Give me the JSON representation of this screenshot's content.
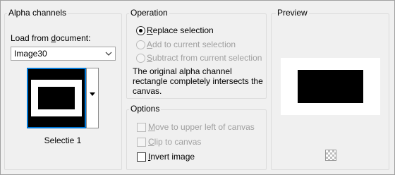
{
  "alpha_channels": {
    "title": "Alpha channels",
    "load_label_pre": "Load from ",
    "load_label_u": "d",
    "load_label_post": "ocument:",
    "document_value": "Image30",
    "thumbnail_label": "Selectie 1"
  },
  "operation": {
    "title": "Operation",
    "options": [
      {
        "u": "R",
        "rest": "eplace selection",
        "checked": true,
        "enabled": true
      },
      {
        "u": "A",
        "rest": "dd to current selection",
        "checked": false,
        "enabled": false
      },
      {
        "u": "S",
        "rest": "ubtract from current selection",
        "checked": false,
        "enabled": false
      }
    ],
    "description": "The original alpha channel rectangle completely intersects the canvas."
  },
  "options": {
    "title": "Options",
    "move": {
      "u": "M",
      "rest": "ove to upper left of canvas",
      "checked": false,
      "enabled": false
    },
    "clip": {
      "u": "C",
      "rest": "lip to canvas",
      "checked": false,
      "enabled": false
    },
    "invert": {
      "u": "I",
      "rest": "nvert image",
      "checked": false,
      "enabled": true
    }
  },
  "preview": {
    "title": "Preview",
    "checker_icon": "transparency-checker-icon"
  }
}
